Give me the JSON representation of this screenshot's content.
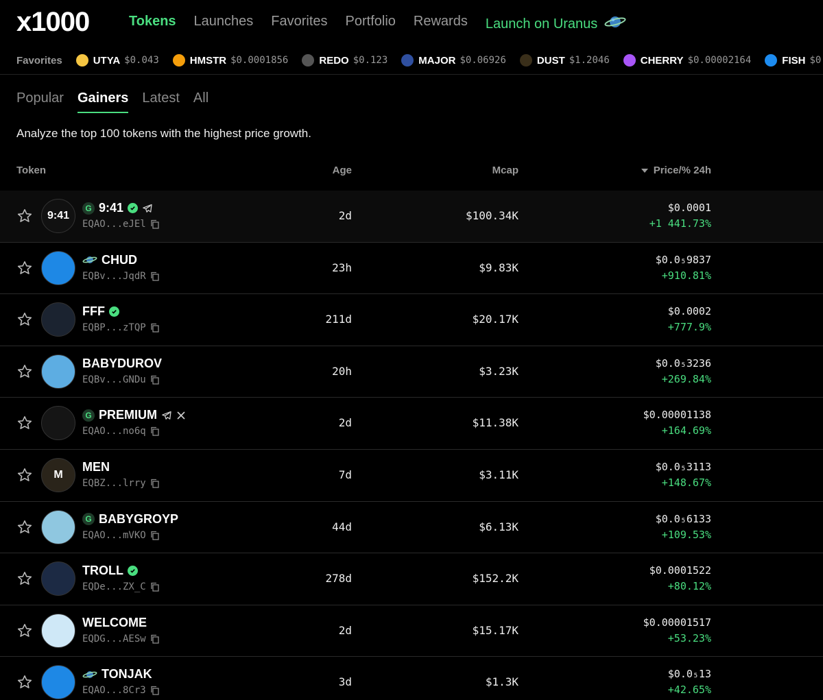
{
  "brand": {
    "logo": "x1000"
  },
  "nav": {
    "items": [
      "Tokens",
      "Launches",
      "Favorites",
      "Portfolio",
      "Rewards"
    ],
    "active": "Tokens",
    "launch_label": "Launch on Uranus"
  },
  "ticker": {
    "label": "Favorites",
    "items": [
      {
        "sym": "UTYA",
        "price": "$0.043",
        "color": "#f5c542"
      },
      {
        "sym": "HMSTR",
        "price": "$0.0001856",
        "color": "#f59e0b"
      },
      {
        "sym": "REDO",
        "price": "$0.123",
        "color": "#555555"
      },
      {
        "sym": "MAJOR",
        "price": "$0.06926",
        "color": "#2f4f9f"
      },
      {
        "sym": "DUST",
        "price": "$1.2046",
        "color": "#3a2f1a"
      },
      {
        "sym": "CHERRY",
        "price": "$0.00002164",
        "color": "#a855f7"
      },
      {
        "sym": "FISH",
        "price": "$0",
        "color": "#1d8cf0"
      }
    ]
  },
  "tabs": [
    "Popular",
    "Gainers",
    "Latest",
    "All"
  ],
  "active_tab": "Gainers",
  "description": "Analyze the top 100 tokens with the highest price growth.",
  "table": {
    "headers": {
      "token": "Token",
      "age": "Age",
      "mcap": "Mcap",
      "price": "Price/% 24h"
    },
    "rows": [
      {
        "name": "9:41",
        "addr": "EQAO...eJEl",
        "age": "2d",
        "mcap": "$100.34K",
        "price": "$0.0001",
        "change": "+1 441.73%",
        "g": true,
        "verified": true,
        "telegram": true,
        "x": false,
        "planet": false,
        "avatar_text": "9:41",
        "avatar_bg": "#111111"
      },
      {
        "name": "CHUD",
        "addr": "EQBv...JqdR",
        "age": "23h",
        "mcap": "$9.83K",
        "price": "$0.0₅9837",
        "change": "+910.81%",
        "g": false,
        "verified": false,
        "telegram": false,
        "x": false,
        "planet": true,
        "avatar_text": "",
        "avatar_bg": "#1e88e5"
      },
      {
        "name": "FFF",
        "addr": "EQBP...zTQP",
        "age": "211d",
        "mcap": "$20.17K",
        "price": "$0.0002",
        "change": "+777.9%",
        "g": false,
        "verified": true,
        "telegram": false,
        "x": false,
        "planet": false,
        "avatar_text": "",
        "avatar_bg": "#1b2330"
      },
      {
        "name": "BABYDUROV",
        "addr": "EQBv...GNDu",
        "age": "20h",
        "mcap": "$3.23K",
        "price": "$0.0₅3236",
        "change": "+269.84%",
        "g": false,
        "verified": false,
        "telegram": false,
        "x": false,
        "planet": false,
        "avatar_text": "",
        "avatar_bg": "#5dade2"
      },
      {
        "name": "PREMIUM",
        "addr": "EQAO...no6q",
        "age": "2d",
        "mcap": "$11.38K",
        "price": "$0.00001138",
        "change": "+164.69%",
        "g": true,
        "verified": false,
        "telegram": true,
        "x": true,
        "planet": false,
        "avatar_text": "",
        "avatar_bg": "#151515"
      },
      {
        "name": "MEN",
        "addr": "EQBZ...lrry",
        "age": "7d",
        "mcap": "$3.11K",
        "price": "$0.0₅3113",
        "change": "+148.67%",
        "g": false,
        "verified": false,
        "telegram": false,
        "x": false,
        "planet": false,
        "avatar_text": "M",
        "avatar_bg": "#2a241a"
      },
      {
        "name": "BABYGROYP",
        "addr": "EQAO...mVKO",
        "age": "44d",
        "mcap": "$6.13K",
        "price": "$0.0₅6133",
        "change": "+109.53%",
        "g": true,
        "verified": false,
        "telegram": false,
        "x": false,
        "planet": false,
        "avatar_text": "",
        "avatar_bg": "#8fc7e0"
      },
      {
        "name": "TROLL",
        "addr": "EQDe...ZX_C",
        "age": "278d",
        "mcap": "$152.2K",
        "price": "$0.0001522",
        "change": "+80.12%",
        "g": false,
        "verified": true,
        "telegram": false,
        "x": false,
        "planet": false,
        "avatar_text": "",
        "avatar_bg": "#1c2a44"
      },
      {
        "name": "WELCOME",
        "addr": "EQDG...AESw",
        "age": "2d",
        "mcap": "$15.17K",
        "price": "$0.00001517",
        "change": "+53.23%",
        "g": false,
        "verified": false,
        "telegram": false,
        "x": false,
        "planet": false,
        "avatar_text": "",
        "avatar_bg": "#cfe8f7"
      },
      {
        "name": "TONJAK",
        "addr": "EQAO...8Cr3",
        "age": "3d",
        "mcap": "$1.3K",
        "price": "$0.0₅13",
        "change": "+42.65%",
        "g": false,
        "verified": false,
        "telegram": false,
        "x": false,
        "planet": true,
        "avatar_text": "",
        "avatar_bg": "#1e88e5"
      }
    ]
  },
  "colors": {
    "accent": "#4ade80",
    "muted": "#9a9a9a",
    "bg": "#000000"
  }
}
